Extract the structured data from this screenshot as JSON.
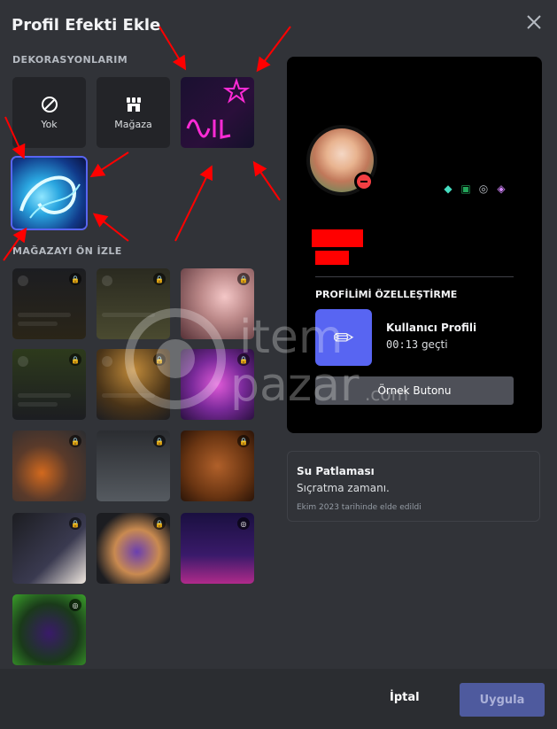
{
  "modal": {
    "title": "Profil Efekti Ekle"
  },
  "sections": {
    "my_decorations": "DEKORASYONLARIM",
    "shop_preview": "MAĞAZAYI ÖN İZLE"
  },
  "tiles": {
    "none_label": "Yok",
    "shop_label": "Mağaza"
  },
  "preview": {
    "section_title": "PROFİLİMİ ÖZELLEŞTİRME",
    "profile_name": "Kullanıcı Profili",
    "time_value": "00:13",
    "time_suffix": " geçti",
    "button_label": "Örnek Butonu"
  },
  "effect_info": {
    "name": "Su Patlaması",
    "description": "Sıçratma zamanı.",
    "acquired": "Ekim 2023 tarihinde elde edildi"
  },
  "footer": {
    "cancel_label": "İptal",
    "apply_label": "Uygula"
  },
  "watermark": {
    "line1": "item",
    "line2": "pazar",
    "suffix": ".com"
  },
  "colors": {
    "accent": "#5865f2",
    "dnd": "#f23f43",
    "annotation_red": "#ff0000"
  }
}
